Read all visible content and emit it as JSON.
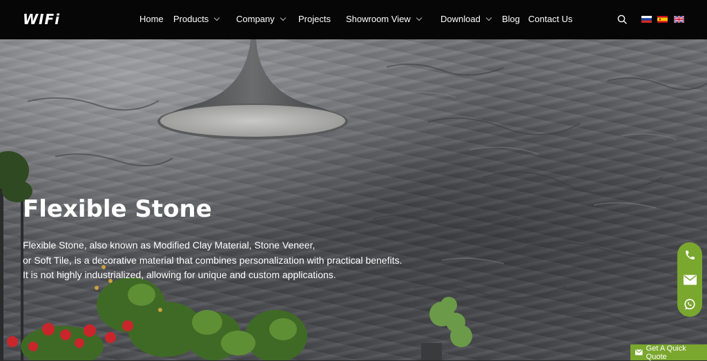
{
  "header": {
    "logo": "WIFi",
    "nav": [
      {
        "label": "Home",
        "dropdown": false
      },
      {
        "label": "Products",
        "dropdown": true
      },
      {
        "label": "Company",
        "dropdown": true
      },
      {
        "label": "Projects",
        "dropdown": false
      },
      {
        "label": "Showroom View",
        "dropdown": true
      },
      {
        "label": "Download",
        "dropdown": true
      },
      {
        "label": "Blog",
        "dropdown": false
      },
      {
        "label": "Contact Us",
        "dropdown": false
      }
    ],
    "search_icon": "search-icon",
    "languages": [
      "russian-flag-icon",
      "spanish-flag-icon",
      "uk-flag-icon"
    ]
  },
  "hero": {
    "title": "Flexible Stone",
    "description": [
      "Flexible Stone, also known as Modified Clay Material, Stone Veneer,",
      "or Soft Tile, is a decorative material that combines personalization with practical benefits.",
      "It is not highly industrialized, allowing for unique and custom applications."
    ]
  },
  "contact": {
    "buttons": [
      "phone-icon",
      "email-icon",
      "whatsapp-icon"
    ],
    "quote_label": "Get A Quick Quote"
  },
  "colors": {
    "header_bg": "#060606",
    "accent_green": "#7aa72e",
    "text": "#ffffff"
  }
}
